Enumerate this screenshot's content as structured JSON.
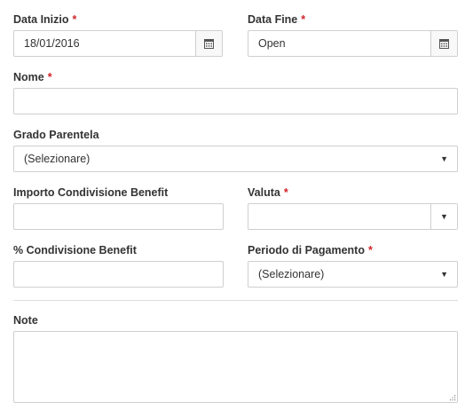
{
  "form": {
    "data_inizio": {
      "label": "Data Inizio",
      "required": "*",
      "value": "18/01/2016",
      "icon": "calendar-icon"
    },
    "data_fine": {
      "label": "Data Fine",
      "required": "*",
      "value": "Open",
      "icon": "calendar-icon"
    },
    "nome": {
      "label": "Nome",
      "required": "*",
      "value": ""
    },
    "grado_parentela": {
      "label": "Grado Parentela",
      "value": "(Selezionare)",
      "caret": "▼"
    },
    "importo": {
      "label": "Importo Condivisione Benefit",
      "value": ""
    },
    "valuta": {
      "label": "Valuta",
      "required": "*",
      "value": "",
      "caret": "▼"
    },
    "percentuale": {
      "label": "% Condivisione Benefit",
      "value": ""
    },
    "periodo": {
      "label": "Periodo di Pagamento",
      "required": "*",
      "value": "(Selezionare)",
      "caret": "▼"
    },
    "note": {
      "label": "Note",
      "value": ""
    }
  },
  "colors": {
    "required": "#d0262b",
    "border": "#cfcfcf",
    "text": "#333333"
  }
}
